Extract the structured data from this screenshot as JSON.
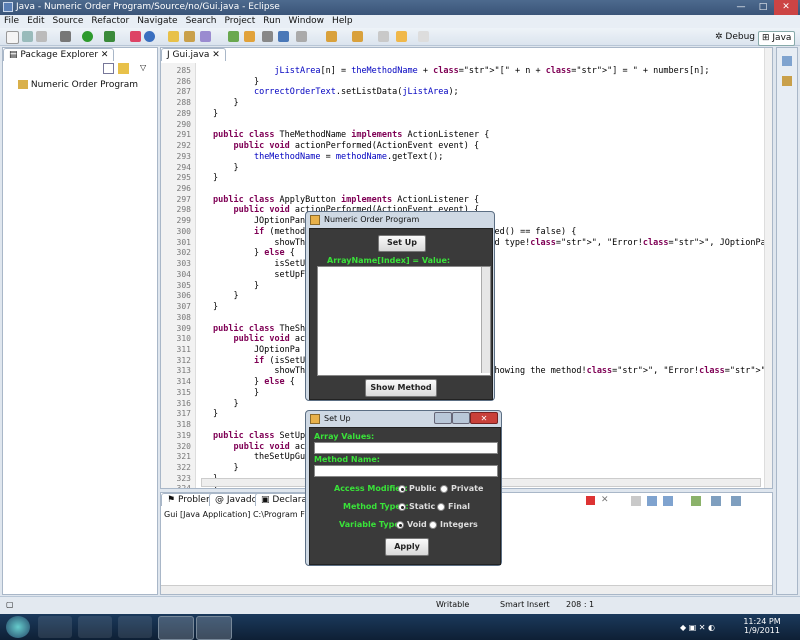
{
  "window": {
    "title": "Java - Numeric Order Program/Source/no/Gui.java - Eclipse"
  },
  "menu": [
    "File",
    "Edit",
    "Source",
    "Refactor",
    "Navigate",
    "Search",
    "Project",
    "Run",
    "Window",
    "Help"
  ],
  "perspectives": {
    "debug": "Debug",
    "java": "Java"
  },
  "package_explorer": {
    "tab": "Package Explorer",
    "items": [
      "Numeric Order Program"
    ]
  },
  "editor": {
    "tab": "Gui.java",
    "lines": [
      {
        "n": "285",
        "code": "            jListArea[n] = theMethodName + \"[\" + n + \"] = \" + numbers[n];"
      },
      {
        "n": "286",
        "code": "        }"
      },
      {
        "n": "287",
        "code": "        correctOrderText.setListData(jListArea);"
      },
      {
        "n": "288",
        "code": "    }"
      },
      {
        "n": "289",
        "code": "}"
      },
      {
        "n": "290",
        "code": ""
      },
      {
        "n": "291",
        "code": "public class TheMethodName implements ActionListener {"
      },
      {
        "n": "292",
        "code": "    public void actionPerformed(ActionEvent event) {"
      },
      {
        "n": "293",
        "code": "        theMethodName = methodName.getText();"
      },
      {
        "n": "294",
        "code": "    }"
      },
      {
        "n": "295",
        "code": "}"
      },
      {
        "n": "296",
        "code": ""
      },
      {
        "n": "297",
        "code": "public class ApplyButton implements ActionListener {"
      },
      {
        "n": "298",
        "code": "    public void actionPerformed(ActionEvent event) {"
      },
      {
        "n": "299",
        "code": "        JOptionPane showTheMethod = new JOptionPane();"
      },
      {
        "n": "300",
        "code": "        if (method                   ds.get(1).isSelected() == false) {"
      },
      {
        "n": "301",
        "code": "            showThe                  ed to have a method type!\", \"Error!\", JOptionPane.ERR"
      },
      {
        "n": "302",
        "code": "        } else {"
      },
      {
        "n": "303",
        "code": "            isSetU"
      },
      {
        "n": "304",
        "code": "            setUpF"
      },
      {
        "n": "305",
        "code": "        }"
      },
      {
        "n": "306",
        "code": "    }"
      },
      {
        "n": "307",
        "code": "}"
      },
      {
        "n": "308",
        "code": ""
      },
      {
        "n": "309",
        "code": "public class TheSh"
      },
      {
        "n": "310",
        "code": "    public void ac"
      },
      {
        "n": "311",
        "code": "        JOptionPa"
      },
      {
        "n": "312",
        "code": "        if (isSetU"
      },
      {
        "n": "313",
        "code": "            showTh                   st set up before showing the method!\", \"Error!\", JOpti"
      },
      {
        "n": "314",
        "code": "        } else {"
      },
      {
        "n": "315",
        "code": "        }"
      },
      {
        "n": "316",
        "code": "    }"
      },
      {
        "n": "317",
        "code": "}"
      },
      {
        "n": "318",
        "code": ""
      },
      {
        "n": "319",
        "code": "public class SetUpB"
      },
      {
        "n": "320",
        "code": "    public void act"
      },
      {
        "n": "321",
        "code": "        theSetUpGui"
      },
      {
        "n": "322",
        "code": "    }"
      },
      {
        "n": "323",
        "code": "}"
      },
      {
        "n": "324",
        "code": "}"
      }
    ]
  },
  "bottom_panel": {
    "tabs": [
      "Problems",
      "Javadoc",
      "Declaration"
    ],
    "console_title": "Gui [Java Application] C:\\Program Files\\Java"
  },
  "statusbar": {
    "mode": "Writable",
    "insert": "Smart Insert",
    "position": "208 : 1"
  },
  "taskbar": {
    "time": "11:24 PM",
    "date": "1/9/2011"
  },
  "dialog_numeric": {
    "title": "Numeric Order Program",
    "setup_button": "Set Up",
    "list_label": "ArrayName[Index] = Value:",
    "show_button": "Show Method"
  },
  "dialog_setup": {
    "title": "Set Up",
    "array_label": "Array Values:",
    "array_value": "",
    "method_label": "Method Name:",
    "method_value": "",
    "access_label": "Access Modifier:",
    "access_options": [
      "Public",
      "Private"
    ],
    "access_selected": "Public",
    "types_label": "Method Types:",
    "types_options": [
      "Static",
      "Final"
    ],
    "types_selected": "Static",
    "var_label": "Variable Type:",
    "var_options": [
      "Void",
      "Integers"
    ],
    "var_selected": "Void",
    "apply_button": "Apply"
  }
}
